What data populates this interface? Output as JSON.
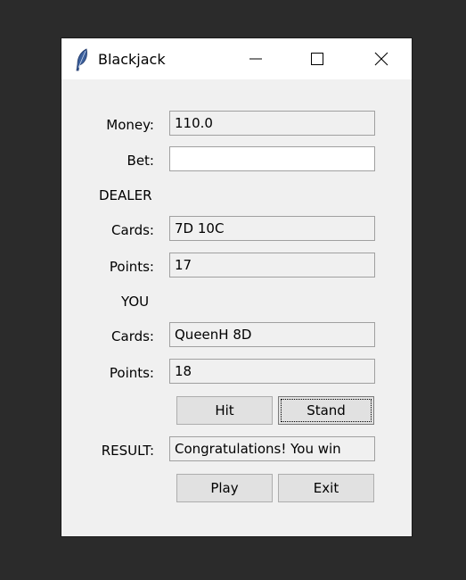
{
  "window": {
    "title": "Blackjack"
  },
  "titlebar_icons": {
    "app": "feather-icon",
    "minimize": "minimize-icon",
    "maximize": "maximize-icon",
    "close": "close-icon"
  },
  "money": {
    "label": "Money:",
    "value": "110.0"
  },
  "bet": {
    "label": "Bet:",
    "value": ""
  },
  "dealer": {
    "heading": "DEALER",
    "cards_label": "Cards:",
    "cards": "7D 10C",
    "points_label": "Points:",
    "points": "17"
  },
  "player": {
    "heading": "YOU",
    "cards_label": "Cards:",
    "cards": "QueenH 8D",
    "points_label": "Points:",
    "points": "18"
  },
  "actions": {
    "hit": "Hit",
    "stand": "Stand"
  },
  "result": {
    "label": "RESULT:",
    "value": "Congratulations! You win"
  },
  "controls": {
    "play": "Play",
    "exit": "Exit"
  }
}
